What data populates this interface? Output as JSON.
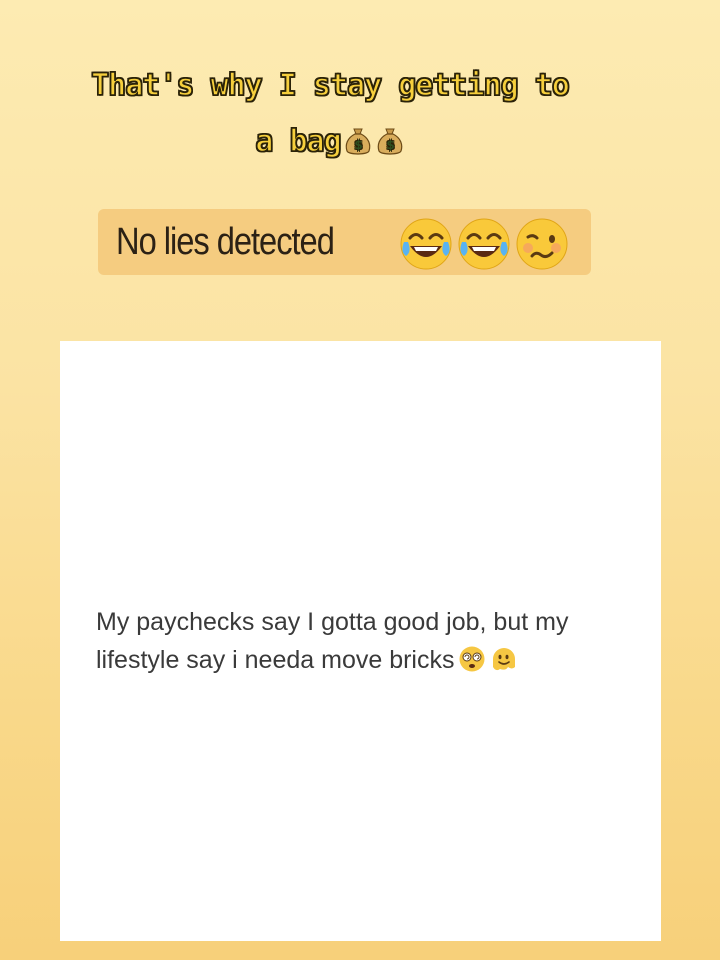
{
  "caption": {
    "line1": "That's why I stay getting to",
    "line2": "a bag",
    "icons": [
      "money-bag-icon",
      "money-bag-icon"
    ]
  },
  "banner": {
    "text": "No lies detected",
    "emojis": [
      "tears-of-joy-emoji",
      "tears-of-joy-emoji",
      "woozy-face-emoji"
    ],
    "background": "#f5cc80"
  },
  "post": {
    "text": "My paychecks say I gotta good job, but my lifestyle say i needa move bricks",
    "emojis": [
      "dizzy-face-emoji",
      "melting-face-emoji"
    ]
  },
  "colors": {
    "caption_fill": "#f6cf3c",
    "caption_outline": "#2a2208",
    "card": "#ffffff",
    "background_top": "#fdebb2",
    "background_bottom": "#f7d07a"
  }
}
